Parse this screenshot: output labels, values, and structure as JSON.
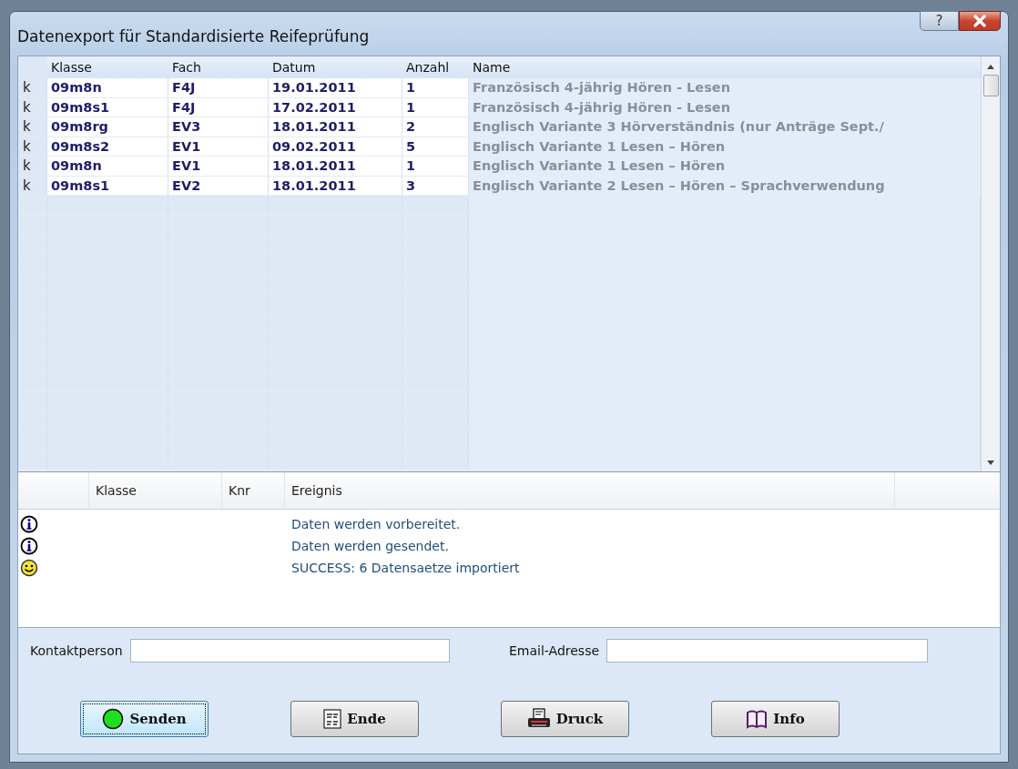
{
  "window": {
    "title": "Datenexport für Standardisierte Reifeprüfung",
    "help_button": "?"
  },
  "grid": {
    "columns": [
      "Klasse",
      "Fach",
      "Datum",
      "Anzahl",
      "Name"
    ],
    "rows": [
      {
        "marker": "k",
        "cells": [
          "09m8n",
          "F4J",
          "19.01.2011",
          "1",
          "Französisch 4-jährig Hören - Lesen"
        ]
      },
      {
        "marker": "k",
        "cells": [
          "09m8s1",
          "F4J",
          "17.02.2011",
          "1",
          "Französisch 4-jährig Hören - Lesen"
        ]
      },
      {
        "marker": "k",
        "cells": [
          "09m8rg",
          "EV3",
          "18.01.2011",
          "2",
          "Englisch Variante 3 Hörverständnis (nur Anträge Sept./"
        ]
      },
      {
        "marker": "k",
        "cells": [
          "09m8s2",
          "EV1",
          "09.02.2011",
          "5",
          "Englisch Variante 1 Lesen – Hören"
        ]
      },
      {
        "marker": "k",
        "cells": [
          "09m8n",
          "EV1",
          "18.01.2011",
          "1",
          "Englisch Variante 1 Lesen – Hören"
        ]
      },
      {
        "marker": "k",
        "cells": [
          "09m8s1",
          "EV2",
          "18.01.2011",
          "3",
          "Englisch Variante 2 Lesen – Hören – Sprachverwendung"
        ]
      }
    ]
  },
  "log": {
    "columns": [
      "Klasse",
      "Knr",
      "Ereignis"
    ],
    "entries": [
      {
        "kind": "info",
        "event": "Daten werden vorbereitet."
      },
      {
        "kind": "info",
        "event": "Daten werden gesendet."
      },
      {
        "kind": "success",
        "event": "SUCCESS: 6 Datensaetze importiert"
      }
    ]
  },
  "fields": [
    {
      "label": "Kontaktperson"
    },
    {
      "label": "Email-Adresse"
    }
  ],
  "buttons": [
    {
      "kind": "send",
      "label": "Senden",
      "focused": true
    },
    {
      "kind": "end",
      "label": "Ende",
      "focused": false
    },
    {
      "kind": "print",
      "label": "Druck",
      "focused": false
    },
    {
      "kind": "info",
      "label": "Info",
      "focused": false
    }
  ]
}
